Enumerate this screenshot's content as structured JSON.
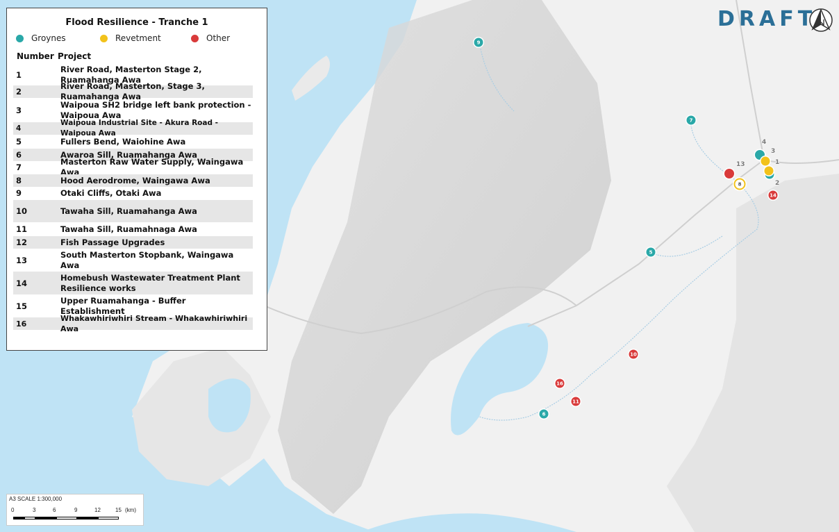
{
  "legend": {
    "title": "Flood Resilience - Tranche 1",
    "categories": [
      {
        "label": "Groynes",
        "color": "#2aa8a8"
      },
      {
        "label": "Revetment",
        "color": "#f2c21b"
      },
      {
        "label": "Other",
        "color": "#d93a3a"
      }
    ],
    "header_number": "Number",
    "header_project": "Project",
    "projects": [
      {
        "number": "1",
        "name": "River Road, Masterton Stage 2, Ruamahanga Awa"
      },
      {
        "number": "2",
        "name": "River Road, Masterton, Stage 3, Ruamahanga Awa"
      },
      {
        "number": "3",
        "name": "Waipoua SH2 bridge left bank protection - Waipoua Awa"
      },
      {
        "number": "4",
        "name": "Waipoua Industrial Site - Akura Road - Waipoua Awa"
      },
      {
        "number": "5",
        "name": "Fullers Bend, Waiohine Awa"
      },
      {
        "number": "6",
        "name": "Awaroa Sill, Ruamahanga Awa"
      },
      {
        "number": "7",
        "name": "Masterton Raw Water Supply, Waingawa Awa"
      },
      {
        "number": "8",
        "name": "Hood Aerodrome, Waingawa Awa"
      },
      {
        "number": "9",
        "name": "Otaki Cliffs, Otaki Awa"
      },
      {
        "number": "10",
        "name": "Tawaha Sill, Ruamahanga Awa"
      },
      {
        "number": "11",
        "name": "Tawaha Sill, Ruamahnaga Awa"
      },
      {
        "number": "12",
        "name": "Fish Passage Upgrades"
      },
      {
        "number": "13",
        "name": "South Masterton Stopbank, Waingawa Awa"
      },
      {
        "number": "14",
        "name": "Homebush Wastewater Treatment Plant Resilience works"
      },
      {
        "number": "15",
        "name": "Upper Ruamahanga - Buffer Establishment"
      },
      {
        "number": "16",
        "name": "Whakawhiriwhiri Stream - Whakawhiriwhiri Awa"
      }
    ]
  },
  "draft_label": "DRAFT",
  "north_icon": "north-arrow-icon",
  "scale_bar": {
    "label": "A3 SCALE    1:300,000",
    "ticks": [
      "0",
      "3",
      "6",
      "9",
      "12",
      "15"
    ],
    "unit": "(km)"
  },
  "markers": [
    {
      "label": "9",
      "type": "Groynes"
    },
    {
      "label": "7",
      "type": "Groynes"
    },
    {
      "label": "4",
      "type": "Groynes"
    },
    {
      "label": "3",
      "type": "Revetment"
    },
    {
      "label": "1",
      "type": "Revetment"
    },
    {
      "label": "2",
      "type": "Groynes"
    },
    {
      "label": "13",
      "type": "Other"
    },
    {
      "label": "8",
      "type": "Revetment"
    },
    {
      "label": "14",
      "type": "Other"
    },
    {
      "label": "5",
      "type": "Groynes"
    },
    {
      "label": "10",
      "type": "Other"
    },
    {
      "label": "16",
      "type": "Other"
    },
    {
      "label": "11",
      "type": "Other"
    },
    {
      "label": "6",
      "type": "Groynes"
    }
  ]
}
